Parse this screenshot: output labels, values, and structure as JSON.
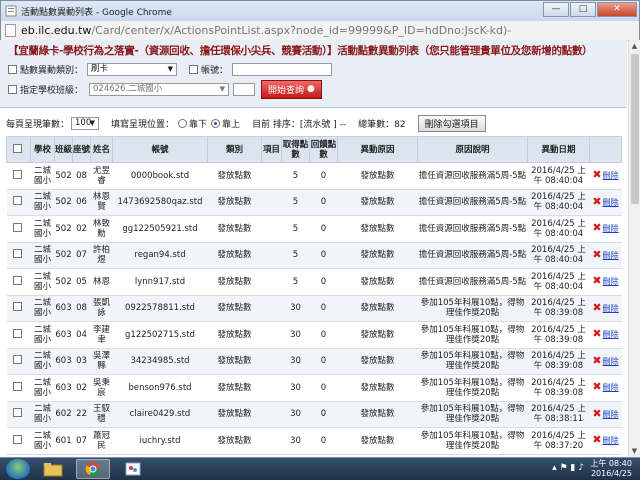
{
  "window": {
    "title": "活動點數異動列表 - Google Chrome"
  },
  "address": {
    "host": "eb.ilc.edu.tw",
    "path": "/Card/center/x/ActionsPointList.aspx?node_id=99999&P_ID=hdDno:JscK-kd)-"
  },
  "filter": {
    "title": "【宜蘭綠卡-學校行為之落實-（資源回收、擔任環保小尖兵、競賽活動）】活動點數異動列表（您只能管理貴單位及您新增的點數）",
    "type_label": "點數異動類別：",
    "type_value": "刷卡",
    "account_label": "帳號：",
    "school_label": "指定學校班級：",
    "school_value": "024626.二城國小",
    "search_button": "開始查詢"
  },
  "toolbar": {
    "per_page_label": "每頁呈現筆數：",
    "per_page_value": "100",
    "order_label": "填寫呈現位置：",
    "opt_desc": "靠下",
    "opt_asc": "靠上",
    "sort_label": "目前 排序：[流水號 ] --",
    "total_label": "總筆數：82",
    "bulk_delete": "刪除勾選項目"
  },
  "table": {
    "headers": [
      "",
      "學校",
      "班級",
      "座號",
      "姓名",
      "帳號",
      "類別",
      "項目",
      "取得點數",
      "回饋點數",
      "異動原因",
      "原因說明",
      "異動日期",
      ""
    ],
    "delete_label": "刪除",
    "rows": [
      {
        "school": "二城國小",
        "class": "502",
        "seat": "08",
        "name": "尤昱睿",
        "account": "0000book.std",
        "type": "發放點數",
        "item": "",
        "points": "5",
        "refund": "0",
        "reason": "發放點數",
        "desc": "擔任資源回收服務滿5周-5點",
        "date": "2016/4/25 上午 08:40:04"
      },
      {
        "school": "二城國小",
        "class": "502",
        "seat": "06",
        "name": "林恩賢",
        "account": "1473692580qaz.std",
        "type": "發放點數",
        "item": "",
        "points": "5",
        "refund": "0",
        "reason": "發放點數",
        "desc": "擔任資源回收服務滿5周-5點",
        "date": "2016/4/25 上午 08:40:04"
      },
      {
        "school": "二城國小",
        "class": "502",
        "seat": "02",
        "name": "林致勳",
        "account": "gg122505921.std",
        "type": "發放點數",
        "item": "",
        "points": "5",
        "refund": "0",
        "reason": "發放點數",
        "desc": "擔任資源回收服務滿5周-5點",
        "date": "2016/4/25 上午 08:40:04"
      },
      {
        "school": "二城國小",
        "class": "502",
        "seat": "07",
        "name": "許柏煜",
        "account": "regan94.std",
        "type": "發放點數",
        "item": "",
        "points": "5",
        "refund": "0",
        "reason": "發放點數",
        "desc": "擔任資源回收服務滿5周-5點",
        "date": "2016/4/25 上午 08:40:04"
      },
      {
        "school": "二城國小",
        "class": "502",
        "seat": "05",
        "name": "林恩",
        "account": "lynn917.std",
        "type": "發放點數",
        "item": "",
        "points": "5",
        "refund": "0",
        "reason": "發放點數",
        "desc": "擔任資源回收服務滿5周-5點",
        "date": "2016/4/25 上午 08:40:04"
      },
      {
        "school": "二城國小",
        "class": "603",
        "seat": "08",
        "name": "張凱詠",
        "account": "0922578811.std",
        "type": "發放點數",
        "item": "",
        "points": "30",
        "refund": "0",
        "reason": "發放點數",
        "desc": "參加105年科展10點，得物理佳作獎20點",
        "date": "2016/4/25 上午 08:39:08"
      },
      {
        "school": "二城國小",
        "class": "603",
        "seat": "04",
        "name": "李建聿",
        "account": "g122502715.std",
        "type": "發放點數",
        "item": "",
        "points": "30",
        "refund": "0",
        "reason": "發放點數",
        "desc": "參加105年科展10點，得物理佳作獎20點",
        "date": "2016/4/25 上午 08:39:08"
      },
      {
        "school": "二城國小",
        "class": "603",
        "seat": "03",
        "name": "吳澤縣",
        "account": "34234985.std",
        "type": "發放點數",
        "item": "",
        "points": "30",
        "refund": "0",
        "reason": "發放點數",
        "desc": "參加105年科展10點，得物理佳作獎20點",
        "date": "2016/4/25 上午 08:39:08"
      },
      {
        "school": "二城國小",
        "class": "603",
        "seat": "02",
        "name": "吳秉宸",
        "account": "benson976.std",
        "type": "發放點數",
        "item": "",
        "points": "30",
        "refund": "0",
        "reason": "發放點數",
        "desc": "參加105年科展10點，得物理佳作獎20點",
        "date": "2016/4/25 上午 08:39:08"
      },
      {
        "school": "二城國小",
        "class": "602",
        "seat": "22",
        "name": "王馭穩",
        "account": "claire0429.std",
        "type": "發放點數",
        "item": "",
        "points": "30",
        "refund": "0",
        "reason": "發放點數",
        "desc": "參加105年科展10點，得物理佳作獎20點",
        "date": "2016/4/25 上午 08:38:11"
      },
      {
        "school": "二城國小",
        "class": "601",
        "seat": "07",
        "name": "蕭冠民",
        "account": "iuchry.std",
        "type": "發放點數",
        "item": "",
        "points": "30",
        "refund": "0",
        "reason": "發放點數",
        "desc": "參加105年科展10點，得物理佳作獎20點",
        "date": "2016/4/25 上午 08:37:20"
      }
    ]
  },
  "taskbar": {
    "time": "上午 08:40",
    "date": "2016/4/25"
  },
  "colors": {
    "title_red": "#8b1a1a",
    "search_red": "#c41818",
    "header_bg": "#dbe4ef"
  }
}
